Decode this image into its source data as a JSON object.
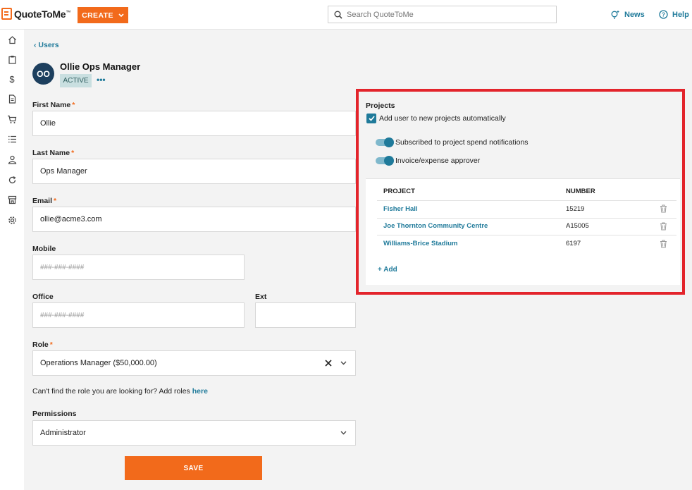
{
  "app": {
    "brand": "QuoteToMe",
    "trademark": "™"
  },
  "topbar": {
    "create_label": "CREATE",
    "search_placeholder": "Search QuoteToMe",
    "news_label": "News",
    "help_label": "Help"
  },
  "sidebar": {
    "icons": [
      "home-icon",
      "clipboard-icon",
      "dollar-icon",
      "document-icon",
      "cart-icon",
      "list-icon",
      "person-icon",
      "refresh-icon",
      "store-icon",
      "gear-icon"
    ]
  },
  "breadcrumb": {
    "back_label": "Users"
  },
  "user": {
    "initials": "OO",
    "name": "Ollie Ops Manager",
    "status": "ACTIVE",
    "more": "•••"
  },
  "form": {
    "first_name": {
      "label": "First Name",
      "required": "*",
      "value": "Ollie"
    },
    "last_name": {
      "label": "Last Name",
      "required": "*",
      "value": "Ops Manager"
    },
    "email": {
      "label": "Email",
      "required": "*",
      "value": "ollie@acme3.com"
    },
    "mobile": {
      "label": "Mobile",
      "placeholder": "###-###-####"
    },
    "office": {
      "label": "Office",
      "placeholder": "###-###-####"
    },
    "ext": {
      "label": "Ext",
      "value": ""
    },
    "role": {
      "label": "Role",
      "required": "*",
      "value": "Operations Manager ($50,000.00)"
    },
    "role_help": {
      "text": "Can't find the role you are looking for? Add roles ",
      "link": "here"
    },
    "permissions": {
      "label": "Permissions",
      "value": "Administrator"
    },
    "save_label": "SAVE"
  },
  "projects": {
    "title": "Projects",
    "auto_add_label": "Add user to new projects automatically",
    "auto_add_checked": true,
    "spend_notifications_label": "Subscribed to project spend notifications",
    "spend_notifications_on": true,
    "approver_label": "Invoice/expense approver",
    "approver_on": true,
    "table": {
      "headers": {
        "project": "PROJECT",
        "number": "NUMBER"
      },
      "rows": [
        {
          "project": "Fisher Hall",
          "number": "15219"
        },
        {
          "project": "Joe Thornton Community Centre",
          "number": "A15005"
        },
        {
          "project": "Williams-Brice Stadium",
          "number": "6197"
        }
      ]
    },
    "add_label": "+ Add"
  },
  "colors": {
    "accent": "#f26a1b",
    "link": "#1f7a9a",
    "highlight_border": "#e3242b",
    "avatar_bg": "#1d3f5e"
  }
}
